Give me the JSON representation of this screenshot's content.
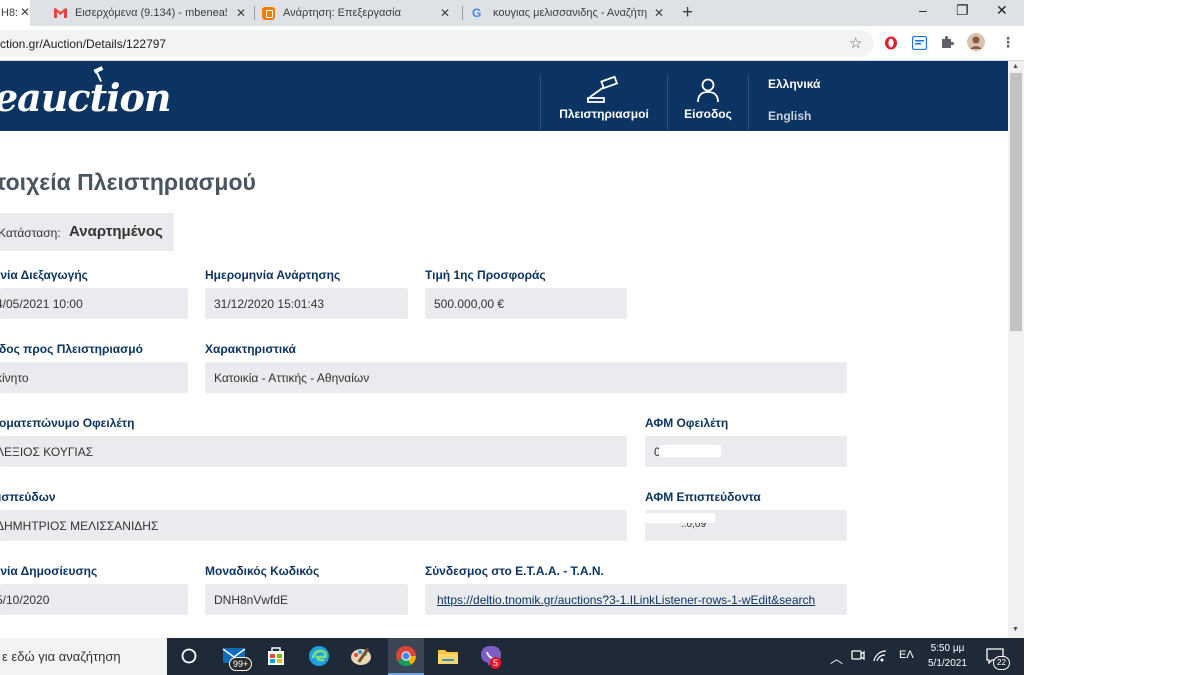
{
  "browser": {
    "tabs": [
      {
        "label": "H8:",
        "active": true
      },
      {
        "label": "Εισερχόμενα (9.134) - mbenea5@",
        "icon": "gmail-icon"
      },
      {
        "label": "Ανάρτηση: Επεξεργασία",
        "icon": "blogger-icon"
      },
      {
        "label": "κουγιας μελισσανιδης - Αναζήτη",
        "icon": "google-icon"
      }
    ],
    "new_tab": "+",
    "window_controls": [
      "–",
      "❐",
      "✕"
    ],
    "url": "ction.gr/Auction/Details/122797"
  },
  "site": {
    "logo": "eauction",
    "nav": {
      "auctions": "Πλειστηριασμοί",
      "login": "Είσοδος",
      "lang_el": "Ελληνικά",
      "lang_en": "English"
    }
  },
  "page": {
    "title": "τοιχεία Πλειστηριασμού",
    "status_label": "Κατάσταση:",
    "status_value": "Αναρτημένος",
    "fields": {
      "date_held_label": "/νία Διεξαγωγής",
      "date_held_value": "4/05/2021 10:00",
      "date_posted_label": "Ημερομηνία Ανάρτησης",
      "date_posted_value": "31/12/2020 15:01:43",
      "first_offer_label": "Τιμή 1ης Προσφοράς",
      "first_offer_value": "500.000,00 €",
      "kind_label": "δος προς Πλειστηριασμό",
      "kind_value": "κίνητο",
      "features_label": "Χαρακτηριστικά",
      "features_value": "Κατοικία - Αττικής - Αθηναίων",
      "debtor_label": "οματεπώνυμο Οφειλέτη",
      "debtor_value": "ΛΕΞΙΟΣ ΚΟΥΓΙΑΣ",
      "debtor_afm_label": "ΑΦΜ Οφειλέτη",
      "debtor_afm_value": "0",
      "creditor_label": "ισπεύδων",
      "creditor_value": "ΔΗΜΗΤΡΙΟΣ ΜΕΛΙΣΣΑΝΙΔΗΣ",
      "creditor_afm_label": "ΑΦΜ Επισπεύδοντα",
      "creditor_afm_value": "..0,09",
      "pub_date_label": "/νία Δημοσίευσης",
      "pub_date_value": "5/10/2020",
      "code_label": "Μοναδικός Κωδικός",
      "code_value": "DNH8nVwfdE",
      "link_label": "Σύνδεσμος στο Ε.Τ.Α.Α. - Τ.Α.Ν.",
      "link_value": "https://deltio.tnomik.gr/auctions?3-1.ILinkListener-rows-1-wEdit&search"
    }
  },
  "taskbar": {
    "search_placeholder": "ε εδώ για αναζήτηση",
    "mail_badge": "99+",
    "viber_badge": "5",
    "lang": "ΕΛ",
    "time": "5:50 μμ",
    "date": "5/1/2021",
    "notif_count": "22"
  }
}
